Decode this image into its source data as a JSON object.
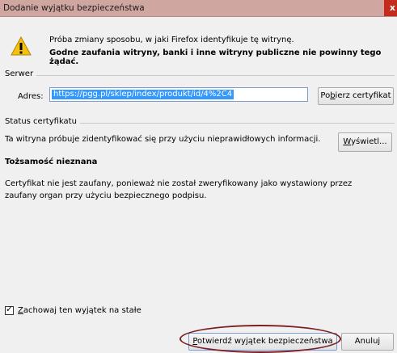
{
  "window": {
    "title": "Dodanie wyjątku bezpieczeństwa",
    "close_glyph": "x"
  },
  "warning": {
    "line1": "Próba zmiany sposobu, w jaki Firefox identyfikuje tę witrynę.",
    "line2": "Godne zaufania witryny, banki i inne witryny publiczne nie powinny tego żądać."
  },
  "server": {
    "legend": "Serwer",
    "address_label": "Adres:",
    "address_value": "https://pgg.pl/sklep/index/produkt/id/4%2C4",
    "get_cert_prefix": "Po",
    "get_cert_accel": "b",
    "get_cert_suffix": "ierz certyfikat"
  },
  "status": {
    "legend": "Status certyfikatu",
    "message": "Ta witryna próbuje zidentyfikować się przy użyciu nieprawidłowych informacji.",
    "view_accel": "W",
    "view_suffix": "yświetl..."
  },
  "identity": {
    "title": "Tożsamość nieznana",
    "description": "Certyfikat nie jest zaufany, ponieważ nie został zweryfikowany jako wystawiony przez zaufany organ przy użyciu bezpiecznego podpisu."
  },
  "permanent": {
    "accel": "Z",
    "label_suffix": "achowaj ten wyjątek na stałe",
    "checked_glyph": "✓"
  },
  "buttons": {
    "confirm_accel": "P",
    "confirm_suffix": "otwierdź wyjątek bezpieczeństwa",
    "cancel": "Anuluj"
  },
  "colors": {
    "titlebar": "#cfa6a0",
    "close": "#c42b1c",
    "selection": "#3399ff",
    "highlight": "#7a1f23",
    "warning": "#f4c20d"
  }
}
